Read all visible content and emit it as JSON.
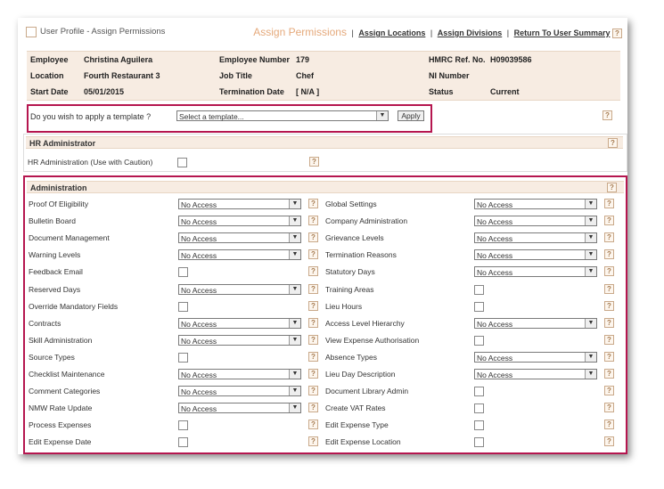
{
  "header": {
    "title": "User Profile - Assign Permissions",
    "nav": {
      "active": "Assign Permissions",
      "links": [
        "Assign Locations",
        "Assign Divisions",
        "Return To User Summary"
      ]
    },
    "help": "?"
  },
  "employee": {
    "employee_label": "Employee",
    "employee_value": "Christina Aguilera",
    "empno_label": "Employee Number",
    "empno_value": "179",
    "hmrc_label": "HMRC Ref. No.",
    "hmrc_value": "H09039586",
    "location_label": "Location",
    "location_value": "Fourth Restaurant 3",
    "jobtitle_label": "Job Title",
    "jobtitle_value": "Chef",
    "ni_label": "NI Number",
    "ni_value": "",
    "start_label": "Start Date",
    "start_value": "05/01/2015",
    "term_label": "Termination Date",
    "term_value": "[ N/A ]",
    "status_label": "Status",
    "status_value": "Current"
  },
  "template": {
    "question": "Do you wish to apply a template ?",
    "select_value": "Select a template...",
    "apply_label": "Apply"
  },
  "hr": {
    "heading": "HR Administrator",
    "item": "HR Administration (Use with Caution)"
  },
  "admin": {
    "heading": "Administration",
    "left": [
      {
        "label": "Proof Of Eligibility",
        "type": "select",
        "value": "No Access"
      },
      {
        "label": "Bulletin Board",
        "type": "select",
        "value": "No Access"
      },
      {
        "label": "Document Management",
        "type": "select",
        "value": "No Access"
      },
      {
        "label": "Warning Levels",
        "type": "select",
        "value": "No Access"
      },
      {
        "label": "Feedback Email",
        "type": "check"
      },
      {
        "label": "Reserved Days",
        "type": "select",
        "value": "No Access"
      },
      {
        "label": "Override Mandatory Fields",
        "type": "check"
      },
      {
        "label": "Contracts",
        "type": "select",
        "value": "No Access"
      },
      {
        "label": "Skill Administration",
        "type": "select",
        "value": "No Access"
      },
      {
        "label": "Source Types",
        "type": "check"
      },
      {
        "label": "Checklist Maintenance",
        "type": "select",
        "value": "No Access"
      },
      {
        "label": "Comment Categories",
        "type": "select",
        "value": "No Access"
      },
      {
        "label": "NMW Rate Update",
        "type": "select",
        "value": "No Access"
      },
      {
        "label": "Process Expenses",
        "type": "check"
      },
      {
        "label": "Edit Expense Date",
        "type": "check"
      }
    ],
    "right": [
      {
        "label": "Global Settings",
        "type": "select",
        "value": "No Access"
      },
      {
        "label": "Company Administration",
        "type": "select",
        "value": "No Access"
      },
      {
        "label": "Grievance Levels",
        "type": "select",
        "value": "No Access"
      },
      {
        "label": "Termination Reasons",
        "type": "select",
        "value": "No Access"
      },
      {
        "label": "Statutory Days",
        "type": "select",
        "value": "No Access"
      },
      {
        "label": "Training Areas",
        "type": "check"
      },
      {
        "label": "Lieu Hours",
        "type": "check"
      },
      {
        "label": "Access Level Hierarchy",
        "type": "select",
        "value": "No Access"
      },
      {
        "label": "View Expense Authorisation",
        "type": "check"
      },
      {
        "label": "Absence Types",
        "type": "select",
        "value": "No Access"
      },
      {
        "label": "Lieu Day Description",
        "type": "select",
        "value": "No Access"
      },
      {
        "label": "Document Library Admin",
        "type": "check"
      },
      {
        "label": "Create VAT Rates",
        "type": "check"
      },
      {
        "label": "Edit Expense Type",
        "type": "check"
      },
      {
        "label": "Edit Expense Location",
        "type": "check"
      }
    ]
  }
}
